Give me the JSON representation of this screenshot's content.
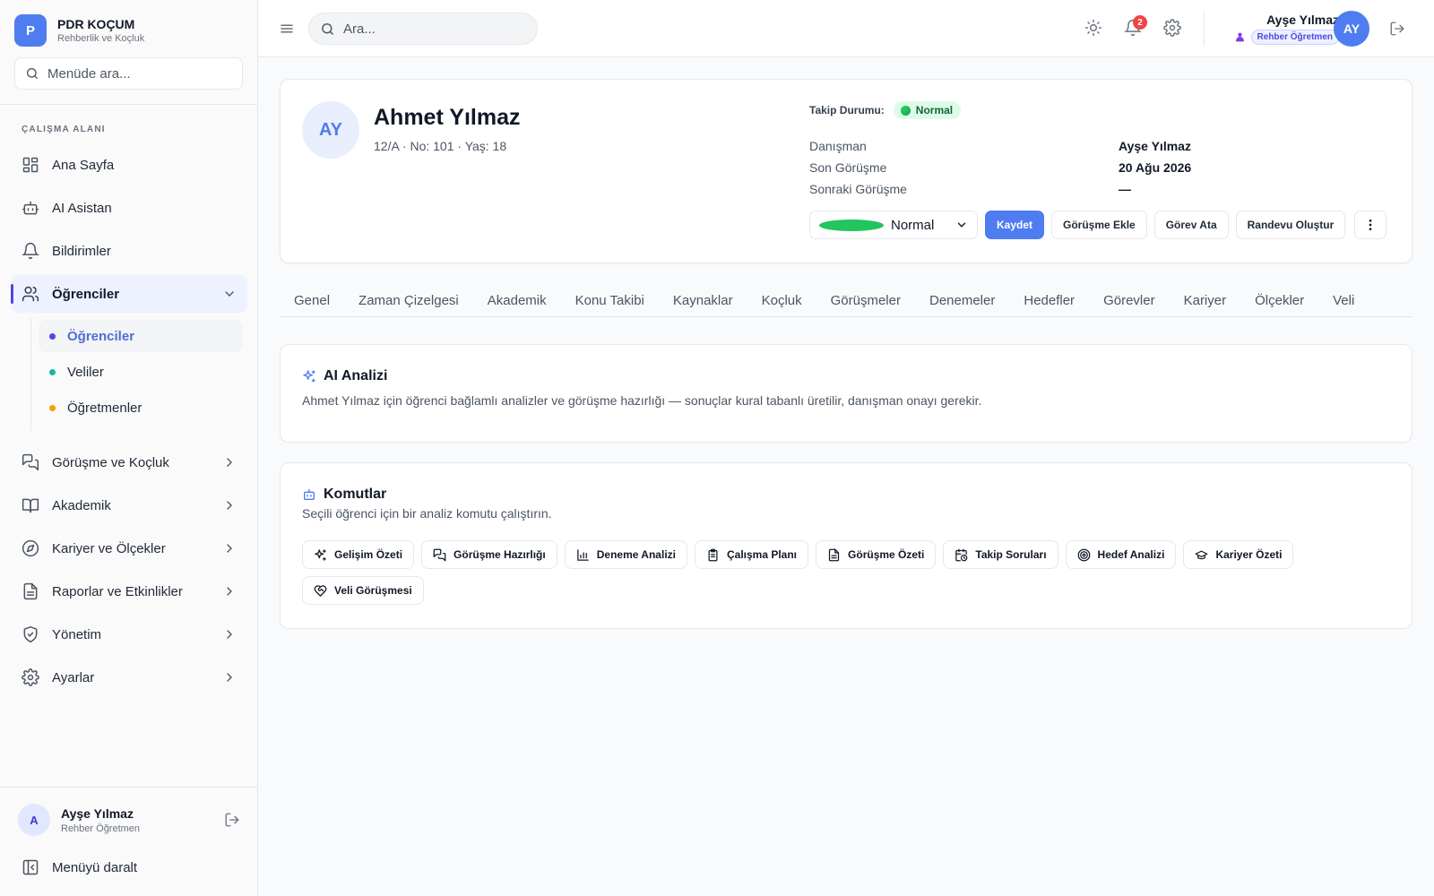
{
  "brand": {
    "logo_letter": "P",
    "title": "PDR KOÇUM",
    "subtitle": "Rehberlik ve Koçluk"
  },
  "sidebar": {
    "search_placeholder": "Menüde ara...",
    "section_label": "ÇALIŞMA ALANI",
    "items": [
      {
        "label": "Ana Sayfa",
        "icon": "dashboard-icon"
      },
      {
        "label": "AI Asistan",
        "icon": "bot-icon"
      },
      {
        "label": "Bildirimler",
        "icon": "bell-icon"
      },
      {
        "label": "Öğrenciler",
        "icon": "users-icon",
        "active": true,
        "expanded": true
      },
      {
        "label": "Görüşme ve Koçluk",
        "icon": "chat-icon"
      },
      {
        "label": "Akademik",
        "icon": "book-icon"
      },
      {
        "label": "Kariyer ve Ölçekler",
        "icon": "compass-icon"
      },
      {
        "label": "Raporlar ve Etkinlikler",
        "icon": "file-icon"
      },
      {
        "label": "Yönetim",
        "icon": "shield-icon"
      },
      {
        "label": "Ayarlar",
        "icon": "gear-icon"
      }
    ],
    "subitems": [
      {
        "label": "Öğrenciler",
        "dot_color": "#4f46e5",
        "active": true
      },
      {
        "label": "Veliler",
        "dot_color": "#14b8a6"
      },
      {
        "label": "Öğretmenler",
        "dot_color": "#f59e0b"
      }
    ],
    "user": {
      "initial": "A",
      "name": "Ayşe Yılmaz",
      "role": "Rehber Öğretmen"
    },
    "collapse_label": "Menüyü daralt"
  },
  "topbar": {
    "search_placeholder": "Ara...",
    "notification_count": "2",
    "user_name": "Ayşe Yılmaz",
    "user_role": "Rehber Öğretmen",
    "avatar_initials": "AY"
  },
  "student": {
    "initials": "AY",
    "name": "Ahmet Yılmaz",
    "meta": "12/A · No: 101 · Yaş: 18",
    "follow_label": "Takip Durumu:",
    "follow_status": "Normal",
    "info": [
      {
        "key": "Danışman",
        "value": "Ayşe Yılmaz"
      },
      {
        "key": "Son Görüşme",
        "value": "20 Ağu 2026"
      },
      {
        "key": "Sonraki Görüşme",
        "value": "—"
      }
    ],
    "select_value": "Normal",
    "buttons": {
      "save": "Kaydet",
      "add_meeting": "Görüşme Ekle",
      "assign_task": "Görev Ata",
      "create_appointment": "Randevu Oluştur"
    }
  },
  "tabs": [
    "Genel",
    "Zaman Çizelgesi",
    "Akademik",
    "Konu Takibi",
    "Kaynaklar",
    "Koçluk",
    "Görüşmeler",
    "Denemeler",
    "Hedefler",
    "Görevler",
    "Kariyer",
    "Ölçekler",
    "Veli"
  ],
  "ai": {
    "title": "AI Analizi",
    "description": "Ahmet Yılmaz için öğrenci bağlamlı analizler ve görüşme hazırlığı — sonuçlar kural tabanlı üretilir, danışman onayı gerekir."
  },
  "commands": {
    "title": "Komutlar",
    "description": "Seçili öğrenci için bir analiz komutu çalıştırın.",
    "items": [
      {
        "label": "Gelişim Özeti",
        "icon": "sparkles-icon"
      },
      {
        "label": "Görüşme Hazırlığı",
        "icon": "chat-icon"
      },
      {
        "label": "Deneme Analizi",
        "icon": "bar-chart-icon"
      },
      {
        "label": "Çalışma Planı",
        "icon": "clipboard-icon"
      },
      {
        "label": "Görüşme Özeti",
        "icon": "file-text-icon"
      },
      {
        "label": "Takip Soruları",
        "icon": "calendar-clock-icon"
      },
      {
        "label": "Hedef Analizi",
        "icon": "target-icon"
      },
      {
        "label": "Kariyer Özeti",
        "icon": "graduation-cap-icon"
      },
      {
        "label": "Veli Görüşmesi",
        "icon": "heart-handshake-icon"
      }
    ]
  },
  "colors": {
    "accent": "#4f7cf0",
    "active_nav": "#4f46e5",
    "status_green": "#22c55e",
    "badge_red": "#ef4444"
  }
}
